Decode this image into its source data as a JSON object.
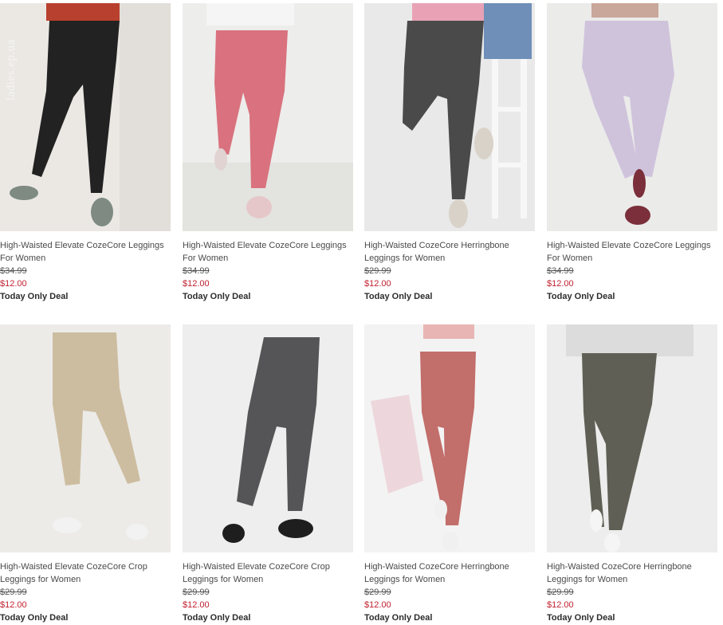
{
  "watermark": "ladies.ep.ua",
  "colors": {
    "sale_price": "#c0202f",
    "original_price": "#555555",
    "deal_text": "#2d2d2d"
  },
  "products": [
    {
      "name": "High-Waisted Elevate CozeCore Leggings For Women",
      "original_price": "$34.99",
      "sale_price": "$12.00",
      "deal": "Today Only Deal",
      "legging_color": "black"
    },
    {
      "name": "High-Waisted Elevate CozeCore Leggings For Women",
      "original_price": "$34.99",
      "sale_price": "$12.00",
      "deal": "Today Only Deal",
      "legging_color": "heather pink"
    },
    {
      "name": "High-Waisted CozeCore Herringbone Leggings for Women",
      "original_price": "$29.99",
      "sale_price": "$12.00",
      "deal": "Today Only Deal",
      "legging_color": "charcoal heather"
    },
    {
      "name": "High-Waisted Elevate CozeCore Leggings For Women",
      "original_price": "$34.99",
      "sale_price": "$12.00",
      "deal": "Today Only Deal",
      "legging_color": "lavender"
    },
    {
      "name": "High-Waisted Elevate CozeCore Crop Leggings for Women",
      "original_price": "$29.99",
      "sale_price": "$12.00",
      "deal": "Today Only Deal",
      "legging_color": "khaki"
    },
    {
      "name": "High-Waisted Elevate CozeCore Crop Leggings for Women",
      "original_price": "$29.99",
      "sale_price": "$12.00",
      "deal": "Today Only Deal",
      "legging_color": "grey heather"
    },
    {
      "name": "High-Waisted CozeCore Herringbone Leggings for Women",
      "original_price": "$29.99",
      "sale_price": "$12.00",
      "deal": "Today Only Deal",
      "legging_color": "dusty rose"
    },
    {
      "name": "High-Waisted CozeCore Herringbone Leggings for Women",
      "original_price": "$29.99",
      "sale_price": "$12.00",
      "deal": "Today Only Deal",
      "legging_color": "olive heather"
    }
  ]
}
